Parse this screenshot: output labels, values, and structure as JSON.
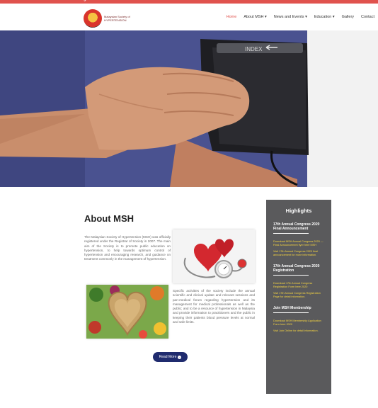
{
  "topbar": {
    "text": "gaeimi"
  },
  "logo": {
    "text": "Malaysian Society of HYPERTENSION"
  },
  "nav": {
    "items": [
      {
        "label": "Home",
        "active": true
      },
      {
        "label": "About MSH ▾",
        "active": false
      },
      {
        "label": "News and Events ▾",
        "active": false
      },
      {
        "label": "Education ▾",
        "active": false
      },
      {
        "label": "Gallery",
        "active": false
      },
      {
        "label": "Contact",
        "active": false
      }
    ]
  },
  "hero": {
    "cuff_label": "INDEX"
  },
  "about": {
    "title": "About MSH",
    "paragraph1": "The Malaysian Society of Hypertension (MSH) was officially registered under the Registrar of Society in 2007. The main aim of the Society is to promote public education on hypertension, to help towards optimum control of hypertension and encouraging research, and guidance on treatment commonly in the management of hypertension.",
    "paragraph2": "Specific activities of the society include the annual scientific and clinical update and relevant sessions and pan-medical forum regarding hypertension and its management for medical professionals as well as the public; and to be a resource of hypertension in Malaysia and provide information to practitioners and the public in keeping their patients blood pressure levels at normal and safe limits.",
    "read_more": "Read More"
  },
  "sidebar": {
    "title": "Highlights",
    "sections": [
      {
        "heading": "17th Annual Congress 2020 Final Announcement",
        "links": [
          "Download MSH Annual Congress 2020 — Final Announcement flyer here MSH",
          "Visit 17th Annual Congress 2020 final announcement for more information."
        ]
      },
      {
        "heading": "17th Annual Congress 2020 Registration",
        "links": [
          "Download 17th Annual Congress Registration Form here 2020",
          "Visit 17th Annual Congress Registration Page for detail information."
        ]
      },
      {
        "heading": "Join MSH Membership",
        "links": [
          "Download MSH Membership Application Form here 2020",
          "Visit Join Online for detail information."
        ]
      }
    ]
  },
  "colors": {
    "accent": "#e0524d",
    "navy": "#1f2b6e",
    "sidebar_bg": "#5a5a5c",
    "link_yellow": "#f7d640"
  }
}
